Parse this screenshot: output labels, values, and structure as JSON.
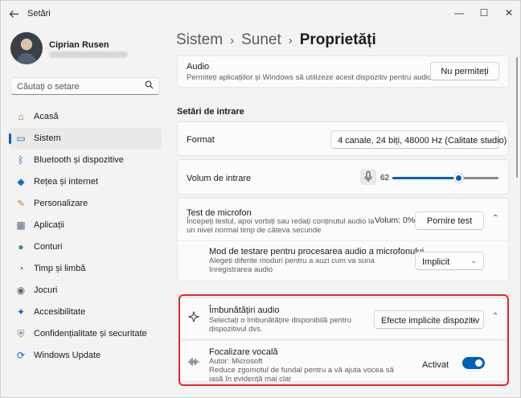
{
  "app": {
    "title": "Setări",
    "back_icon": "back-arrow-icon"
  },
  "window_controls": {
    "minimize": "—",
    "maximize": "☐",
    "close": "✕"
  },
  "profile": {
    "name": "Ciprian Rusen"
  },
  "search": {
    "placeholder": "Căutați o setare",
    "icon": "🔍"
  },
  "sidebar": {
    "items": [
      {
        "label": "Acasă",
        "icon": "home-icon",
        "glyph": "⌂",
        "color": "#c0662b"
      },
      {
        "label": "Sistem",
        "icon": "system-icon",
        "glyph": "▭",
        "color": "#0078d4",
        "active": true
      },
      {
        "label": "Bluetooth și dispozitive",
        "icon": "bluetooth-icon",
        "glyph": "ᛒ",
        "color": "#0067c0"
      },
      {
        "label": "Rețea și internet",
        "icon": "wifi-icon",
        "glyph": "◆",
        "color": "#1b6ec2"
      },
      {
        "label": "Personalizare",
        "icon": "brush-icon",
        "glyph": "✎",
        "color": "#d08a2b"
      },
      {
        "label": "Aplicații",
        "icon": "apps-icon",
        "glyph": "▦",
        "color": "#5a6a7a"
      },
      {
        "label": "Conturi",
        "icon": "account-icon",
        "glyph": "●",
        "color": "#2aa05c"
      },
      {
        "label": "Timp și limbă",
        "icon": "globe-clock-icon",
        "glyph": "◔",
        "color": "#1c7bd0"
      },
      {
        "label": "Jocuri",
        "icon": "gamepad-icon",
        "glyph": "◉",
        "color": "#606a74"
      },
      {
        "label": "Accesibilitate",
        "icon": "accessibility-icon",
        "glyph": "✦",
        "color": "#1466c8"
      },
      {
        "label": "Confidențialitate și securitate",
        "icon": "shield-icon",
        "glyph": "⛨",
        "color": "#6b7785"
      },
      {
        "label": "Windows Update",
        "icon": "update-icon",
        "glyph": "⟳",
        "color": "#0a6cc8"
      }
    ]
  },
  "breadcrumb": {
    "item1": "Sistem",
    "sep": "›",
    "item2": "Sunet",
    "current": "Proprietăți"
  },
  "audio_card": {
    "title": "Audio",
    "description": "Permiteți aplicațiilor și Windows să utilizeze acest dispozitiv pentru audio",
    "button": "Nu permiteți"
  },
  "input_section": {
    "heading": "Setări de intrare"
  },
  "format_card": {
    "title": "Format",
    "value": "4 canale, 24 biți, 48000 Hz (Calitate studio)"
  },
  "volume_card": {
    "title": "Volum de intrare",
    "value": "62",
    "level": 0.62,
    "icon": "microphone-icon"
  },
  "mic_test_card": {
    "title": "Test de microfon",
    "description": "Începeți testul, apoi vorbiți sau redați conținutul audio la un nivel normal timp de câteva secunde",
    "volume_label": "Volum: 0%",
    "button": "Pornire test",
    "sub_title": "Mod de testare pentru procesarea audio a microfonului",
    "sub_description": "Alegeți diferite moduri pentru a auzi cum va suna înregistrarea audio",
    "sub_value": "Implicit"
  },
  "enhance_card": {
    "title": "Îmbunătățiri audio",
    "description": "Selectați o îmbunătățire disponibilă pentru dispozitivul dvs.",
    "value": "Efecte implicite dispozitiv",
    "icon": "sparkle-icon"
  },
  "voice_card": {
    "title": "Focalizare vocală",
    "author": "Autor: Microsoft",
    "description": "Reduce zgomotul de fundal pentru a vă ajuta vocea să iasă în evidență mai clar",
    "state": "Activat",
    "enabled": true,
    "icon": "voice-focus-icon"
  },
  "colors": {
    "accent": "#005fb8",
    "highlight": "#e0282c"
  }
}
